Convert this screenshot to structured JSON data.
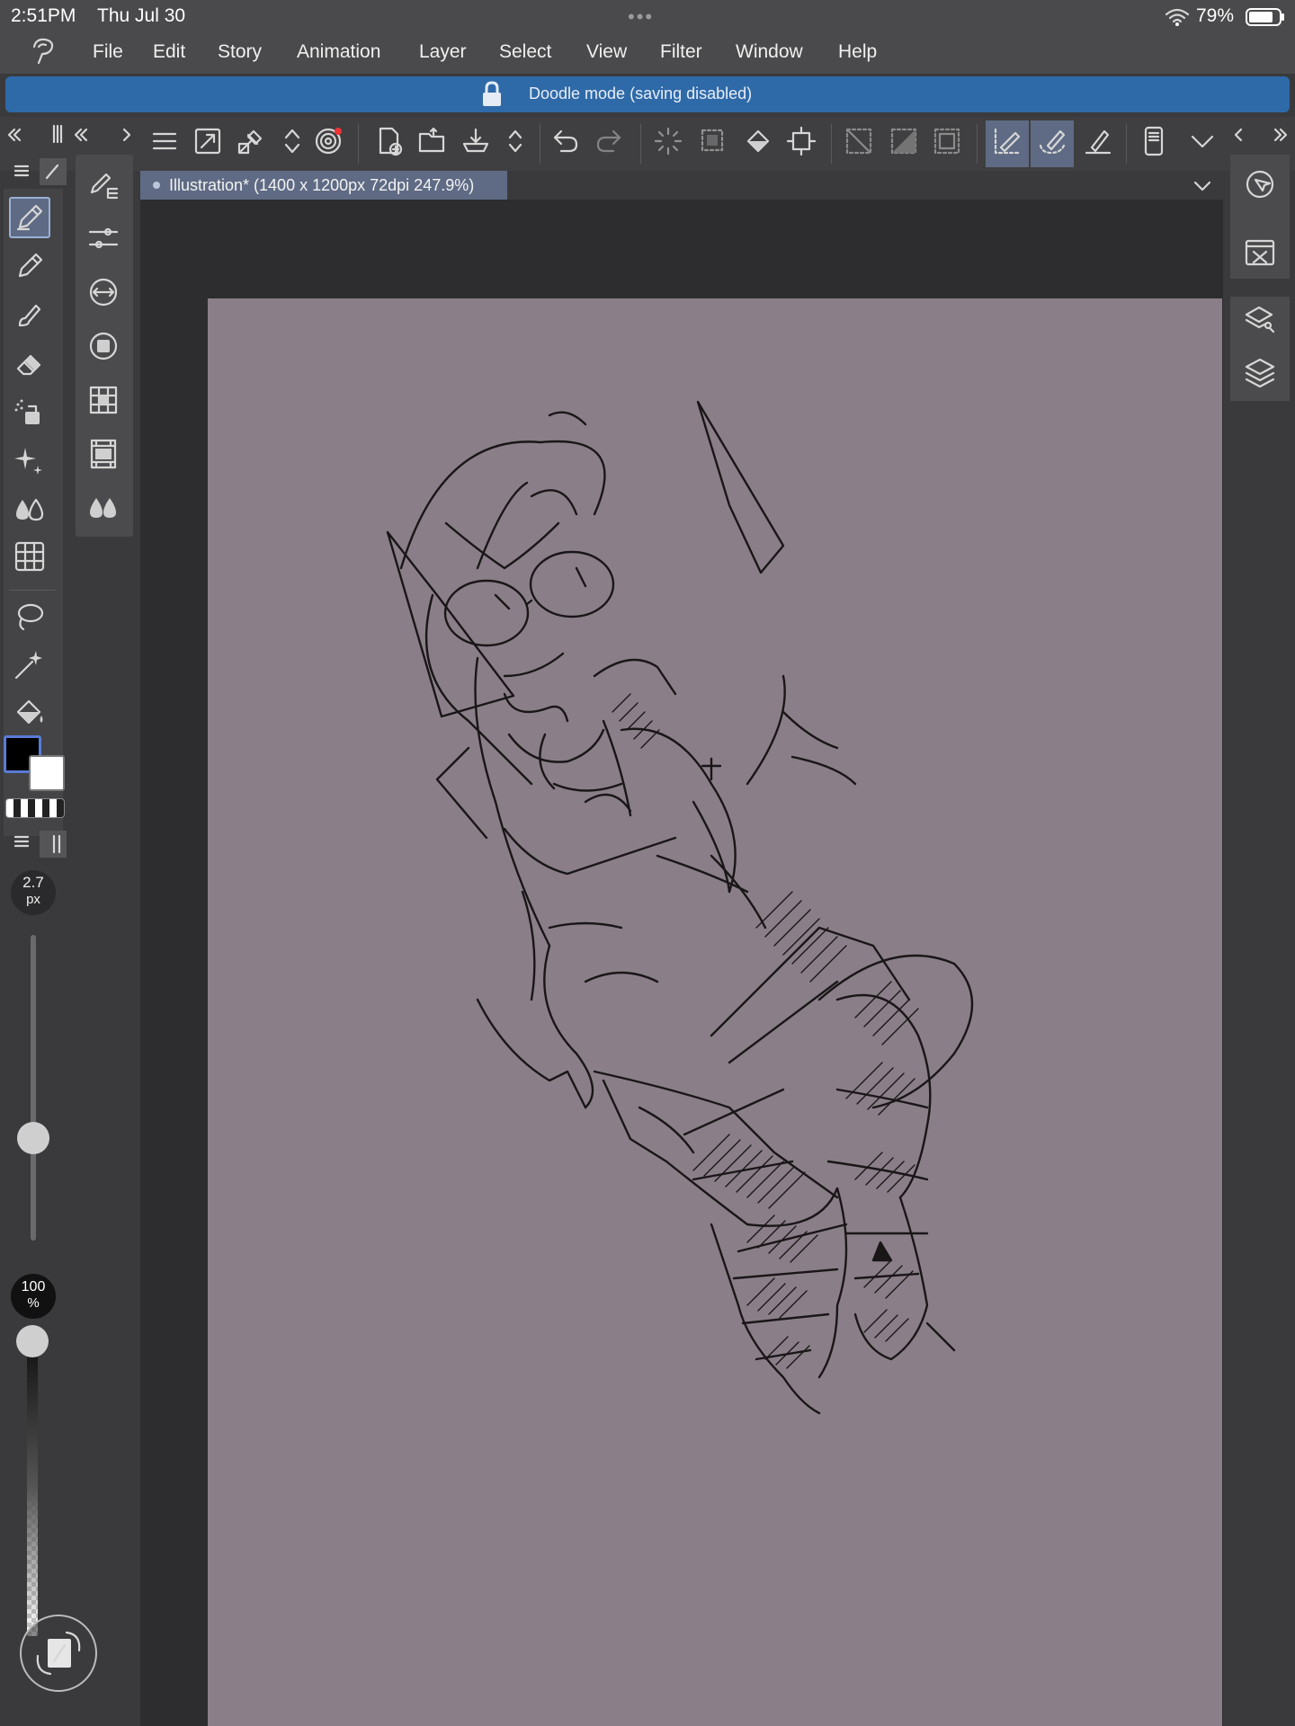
{
  "status_bar": {
    "time": "2:51PM",
    "date": "Thu Jul 30",
    "dots": "•••",
    "battery": "79%"
  },
  "menu": [
    "File",
    "Edit",
    "Story",
    "Animation",
    "Layer",
    "Select",
    "View",
    "Filter",
    "Window",
    "Help"
  ],
  "banner": {
    "text": "Doodle mode (saving disabled)"
  },
  "canvas": {
    "title": "Illustration* (1400 x 1200px 72dpi 247.9%)"
  },
  "brush": {
    "size_value": "2.7",
    "size_unit": "px",
    "opacity_value": "100",
    "opacity_unit": "%"
  },
  "colors": {
    "accent": "#2f6aa8",
    "selection": "#5f6b84",
    "canvas": "#8a7f88",
    "main_color": "#000000",
    "sub_color": "#ffffff"
  }
}
